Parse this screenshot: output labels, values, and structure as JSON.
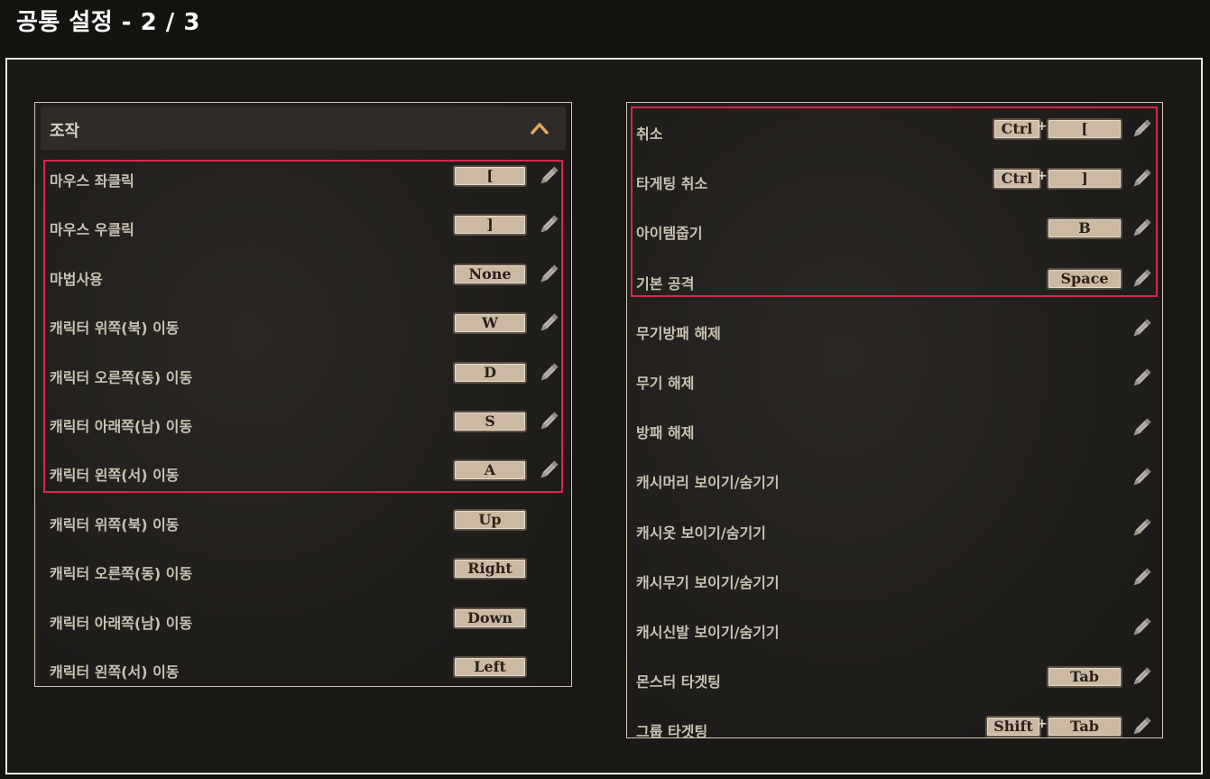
{
  "page_title": "공통 설정 - 2 / 3",
  "left": {
    "section_title": "조작",
    "rows": [
      {
        "name": "마우스 좌클릭",
        "key": "["
      },
      {
        "name": "마우스 우클릭",
        "key": "]"
      },
      {
        "name": "마법사용",
        "key": "None"
      },
      {
        "name": "캐릭터 위쪽(북) 이동",
        "key": "W"
      },
      {
        "name": "캐릭터 오른쪽(동) 이동",
        "key": "D"
      },
      {
        "name": "캐릭터 아래쪽(남) 이동",
        "key": "S"
      },
      {
        "name": "캐릭터 왼쪽(서) 이동",
        "key": "A"
      },
      {
        "name": "캐릭터 위쪽(북) 이동",
        "key": "Up"
      },
      {
        "name": "캐릭터 오른쪽(동) 이동",
        "key": "Right"
      },
      {
        "name": "캐릭터 아래쪽(남) 이동",
        "key": "Down"
      },
      {
        "name": "캐릭터 왼쪽(서) 이동",
        "key": "Left"
      }
    ]
  },
  "right": {
    "rows": [
      {
        "name": "취소",
        "mod": "Ctrl",
        "key": "["
      },
      {
        "name": "타게팅 취소",
        "mod": "Ctrl",
        "key": "]"
      },
      {
        "name": "아이템줍기",
        "key": "B"
      },
      {
        "name": "기본 공격",
        "key": "Space"
      },
      {
        "name": "무기방패 해제"
      },
      {
        "name": "무기 해제"
      },
      {
        "name": "방패 해제"
      },
      {
        "name": "캐시머리 보이기/숨기기"
      },
      {
        "name": "캐시옷 보이기/숨기기"
      },
      {
        "name": "캐시무기 보이기/숨기기"
      },
      {
        "name": "캐시신발 보이기/숨기기"
      },
      {
        "name": "몬스터 타겟팅",
        "key": "Tab"
      },
      {
        "name": "그룹 타겟팅",
        "mod": "Shift",
        "key": "Tab"
      }
    ]
  },
  "plus_sign": "+",
  "icons": {
    "edit": "pencil-icon",
    "collapse": "chevron-up-icon"
  },
  "colors": {
    "highlight": "#d8264a",
    "key_bg": "#cbb9a3",
    "accent": "#e0a95a"
  }
}
